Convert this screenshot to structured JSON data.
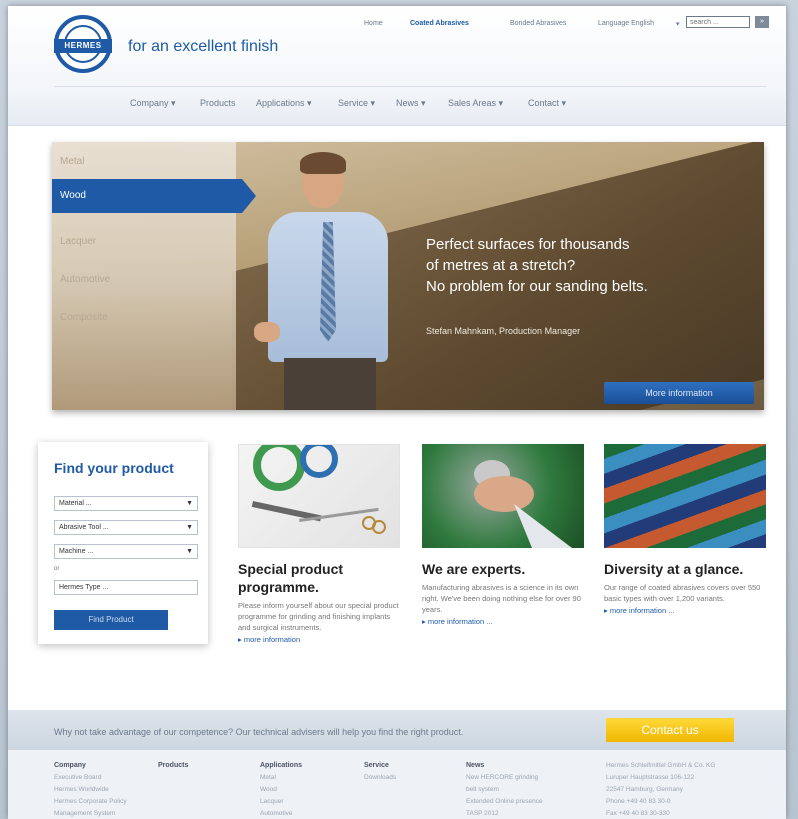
{
  "header": {
    "logo_text": "HERMES",
    "tagline": "for an excellent finish",
    "top_links": [
      "Home",
      "Coated Abrasives",
      "Bonded Abrasives"
    ],
    "language_label": "Language English",
    "search_placeholder": "search ...",
    "search_button": "»"
  },
  "main_nav": [
    "Company ▾",
    "Products",
    "Applications ▾",
    "Service ▾",
    "News ▾",
    "Sales Areas ▾",
    "Contact ▾"
  ],
  "hero": {
    "categories": [
      "Metal",
      "Wood",
      "Lacquer",
      "Automotive",
      "Composite"
    ],
    "active_category": "Wood",
    "headline": [
      "Perfect surfaces for thousands",
      "of metres at a stretch?",
      "No problem for our sanding belts."
    ],
    "citation": "Stefan Mahnkam, Production Manager",
    "more_button": "More information"
  },
  "finder": {
    "title": "Find your product",
    "material": "Material ...",
    "abrasive_tool": "Abrasive Tool ...",
    "machine": "Machine ...",
    "or_label": "or",
    "hermes_type": "Hermes Type ...",
    "button": "Find Product"
  },
  "features": [
    {
      "title": "Special product programme.",
      "text": "Please inform yourself about our special product programme for grinding and finishing implants and surgical instruments.",
      "more": "more information"
    },
    {
      "title": "We are experts.",
      "text": "Manufacturing abrasives is a science in its own right. We've been doing nothing else for over 90 years.",
      "more": "more information ..."
    },
    {
      "title": "Diversity at a glance.",
      "text": "Our range of coated abrasives covers over 550 basic types with over 1,200 variants.",
      "more": "more information ..."
    }
  ],
  "band": {
    "text": "Why not take advantage of our competence? Our technical advisers will help you find the right product.",
    "button": "Contact us"
  },
  "footer": {
    "company": {
      "title": "Company",
      "items": [
        "Executive Board",
        "Hermes Worldwide",
        "Hermes Corporate Policy",
        "Management System"
      ]
    },
    "products": {
      "title": "Products"
    },
    "applications": {
      "title": "Applications",
      "items": [
        "Metal",
        "Wood",
        "Lacquer",
        "Automotive"
      ]
    },
    "service": {
      "title": "Service",
      "items": [
        "Downloads"
      ]
    },
    "news": {
      "title": "News",
      "items": [
        "New HERCORE grinding",
        "belt system",
        "Extended Online presence",
        "TASP 2012"
      ]
    },
    "address": [
      "Hermes Schleifmittel GmbH & Co. KG",
      "Luruper Hauptstrasse 106-122",
      "22547 Hamburg, Germany",
      "Phone +49 40 83 30-0",
      "Fax +49 40 83 30-330"
    ]
  },
  "colors": {
    "brand_blue": "#1f5aa6",
    "contact_yellow": "#f0b800"
  }
}
